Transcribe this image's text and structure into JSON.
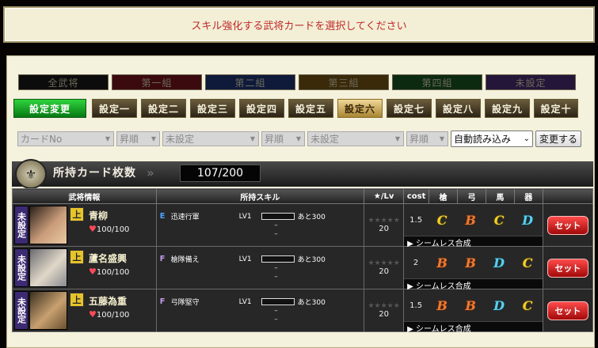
{
  "message": "スキル強化する武将カードを選択してください",
  "groups": [
    "全武将",
    "第一組",
    "第二組",
    "第三組",
    "第四組",
    "未設定"
  ],
  "settings": [
    "設定変更",
    "設定一",
    "設定二",
    "設定三",
    "設定四",
    "設定五",
    "設定六",
    "設定七",
    "設定八",
    "設定九",
    "設定十"
  ],
  "filters": [
    "カードNo",
    "昇順",
    "未設定",
    "昇順",
    "未設定",
    "昇順"
  ],
  "select_value": "自動読み込み",
  "change_label": "変更する",
  "section_title": "所持カード枚数",
  "card_count": "107/200",
  "columns": [
    "武将情報",
    "所持スキル",
    "★/Lv",
    "cost",
    "槍",
    "弓",
    "馬",
    "器"
  ],
  "rows": [
    {
      "status": "未設定",
      "badge": "上",
      "name": "青柳",
      "hp": "100/100",
      "skill_rank": "E",
      "skill_name": "迅速行軍",
      "skill_lv": "LV1",
      "next": "あと300",
      "dash1": "–",
      "dash2": "–",
      "stars": "★★★★★",
      "lv": "20",
      "cost": "1.5",
      "apt": [
        "C",
        "B",
        "C",
        "D"
      ],
      "seamless": "▶ シームレス合成",
      "set": "セット"
    },
    {
      "status": "未設定",
      "badge": "上",
      "name": "蘆名盛興",
      "hp": "100/100",
      "skill_rank": "F",
      "skill_name": "槍隊備え",
      "skill_lv": "LV1",
      "next": "あと300",
      "dash1": "–",
      "dash2": "–",
      "stars": "★★★★★",
      "lv": "20",
      "cost": "2",
      "apt": [
        "B",
        "B",
        "D",
        "C"
      ],
      "seamless": "▶ シームレス合成",
      "set": "セット"
    },
    {
      "status": "未設定",
      "badge": "上",
      "name": "五藤為重",
      "hp": "100/100",
      "skill_rank": "F",
      "skill_name": "弓隊堅守",
      "skill_lv": "LV1",
      "next": "あと300",
      "dash1": "–",
      "dash2": "–",
      "stars": "★★★★★",
      "lv": "20",
      "cost": "1.5",
      "apt": [
        "B",
        "B",
        "D",
        "C"
      ],
      "seamless": "▶ シームレス合成",
      "set": "セット"
    }
  ]
}
